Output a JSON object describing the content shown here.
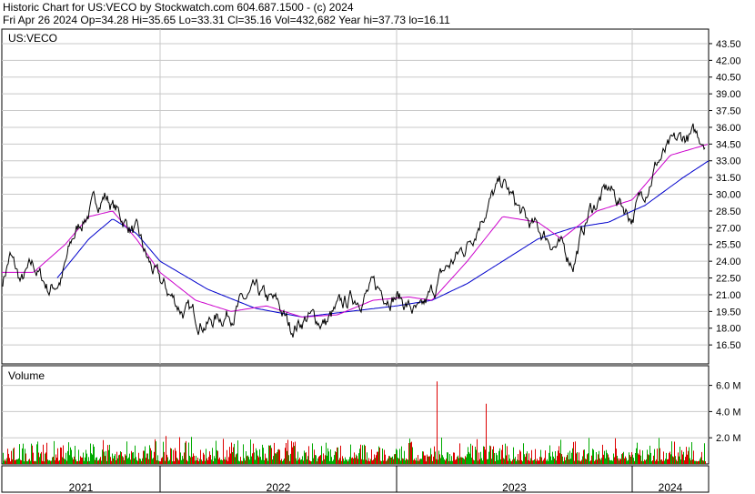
{
  "header": {
    "line1": "Historic Chart for US:VECO by Stockwatch.com 604.687.1500 - (c) 2024",
    "line2": "Fri Apr 26 2024   Op=34.28   Hi=35.65   Lo=33.31   Cl=35.16   Vol=432,682   Year hi=37.73   lo=16.11"
  },
  "symbol_label": "US:VECO",
  "volume_label": "Volume",
  "colors": {
    "price": "#000000",
    "ma_short": "#cc00cc",
    "ma_long": "#0000cc",
    "vol_up": "#00aa00",
    "vol_down": "#dd0000",
    "grid": "#c8c8c8"
  },
  "chart_data": [
    {
      "type": "line",
      "title": "Historic Chart for US:VECO",
      "y_ticks": [
        "43.50",
        "42.00",
        "40.50",
        "39.00",
        "37.50",
        "36.00",
        "34.50",
        "33.00",
        "31.50",
        "30.00",
        "28.50",
        "27.00",
        "25.50",
        "24.00",
        "22.50",
        "21.00",
        "19.50",
        "18.00",
        "16.50"
      ],
      "ylim": [
        14.8,
        44.8
      ],
      "x_labels": [
        "2021",
        "2022",
        "2023",
        "2024"
      ],
      "series": [
        {
          "role": "close",
          "x": [
            0,
            0.05,
            0.12,
            0.2,
            0.3,
            0.38,
            0.45,
            0.5,
            0.55,
            0.65,
            0.75,
            0.85,
            0.92,
            1.0,
            1.1,
            1.2,
            1.3,
            1.4,
            1.5,
            1.55,
            1.62,
            1.7,
            1.8,
            1.9,
            2.0,
            2.1,
            2.2,
            2.3,
            2.38,
            2.45,
            2.55,
            2.65,
            2.75,
            2.82,
            2.9,
            3.0,
            3.1,
            3.2,
            3.3
          ],
          "values": [
            22.0,
            24.5,
            22.0,
            23.5,
            21.5,
            22.5,
            26.0,
            27.5,
            28.5,
            30.0,
            28.0,
            26.5,
            24.0,
            22.0,
            19.5,
            18.5,
            19.5,
            21.0,
            20.0,
            18.0,
            19.0,
            18.5,
            20.5,
            21.5,
            21.0,
            19.0,
            23.0,
            25.5,
            29.0,
            31.0,
            27.5,
            26.0,
            24.0,
            28.5,
            30.5,
            28.0,
            33.0,
            35.0,
            35.2
          ]
        },
        {
          "role": "moving-average-short",
          "x": [
            0,
            0.2,
            0.4,
            0.55,
            0.7,
            0.85,
            1.0,
            1.15,
            1.3,
            1.45,
            1.6,
            1.75,
            1.9,
            2.05,
            2.15,
            2.3,
            2.45,
            2.6,
            2.7,
            2.85,
            3.0,
            3.15,
            3.3
          ],
          "values": [
            23.0,
            23.0,
            25.5,
            28.0,
            28.5,
            26.0,
            23.0,
            20.5,
            19.5,
            20.0,
            19.0,
            19.2,
            20.5,
            20.8,
            20.5,
            24.0,
            28.0,
            27.5,
            26.0,
            28.5,
            29.5,
            33.5,
            34.5
          ]
        },
        {
          "role": "moving-average-long",
          "x": [
            0.35,
            0.55,
            0.7,
            0.85,
            1.0,
            1.2,
            1.4,
            1.6,
            1.8,
            2.0,
            2.15,
            2.3,
            2.45,
            2.6,
            2.75,
            2.9,
            3.05,
            3.2,
            3.3
          ],
          "values": [
            22.5,
            26.0,
            27.8,
            26.5,
            24.0,
            21.5,
            19.8,
            19.0,
            19.5,
            20.0,
            20.5,
            22.0,
            24.0,
            26.0,
            27.0,
            27.5,
            29.0,
            31.5,
            33.0
          ]
        }
      ]
    },
    {
      "type": "bar",
      "title": "Volume",
      "y_ticks": [
        "6.0 M",
        "4.0 M",
        "2.0 M"
      ],
      "ylim": [
        0,
        7.5
      ],
      "spikes": [
        {
          "x": 2.17,
          "value": 6.3
        },
        {
          "x": 2.38,
          "value": 4.6
        }
      ],
      "typical_range": [
        0.2,
        1.5
      ]
    }
  ]
}
